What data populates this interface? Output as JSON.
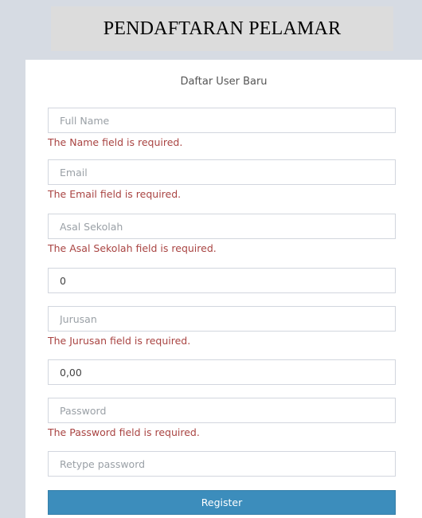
{
  "header": {
    "title": "PENDAFTARAN PELAMAR"
  },
  "form": {
    "subtitle": "Daftar User Baru",
    "full_name": {
      "placeholder": "Full Name",
      "value": "",
      "error": "The Name field is required."
    },
    "email": {
      "placeholder": "Email",
      "value": "",
      "error": "The Email field is required."
    },
    "asal_sekolah": {
      "placeholder": "Asal Sekolah",
      "value": "",
      "error": "The Asal Sekolah field is required."
    },
    "number_field": {
      "value": "0"
    },
    "jurusan": {
      "placeholder": "Jurusan",
      "value": "",
      "error": "The Jurusan field is required."
    },
    "score_field": {
      "value": "0,00"
    },
    "password": {
      "placeholder": "Password",
      "value": "",
      "error": "The Password field is required."
    },
    "retype_password": {
      "placeholder": "Retype password",
      "value": ""
    },
    "register_label": "Register"
  },
  "colors": {
    "error": "#a94442",
    "button": "#3c8dbc",
    "background": "#d6dbe3"
  }
}
